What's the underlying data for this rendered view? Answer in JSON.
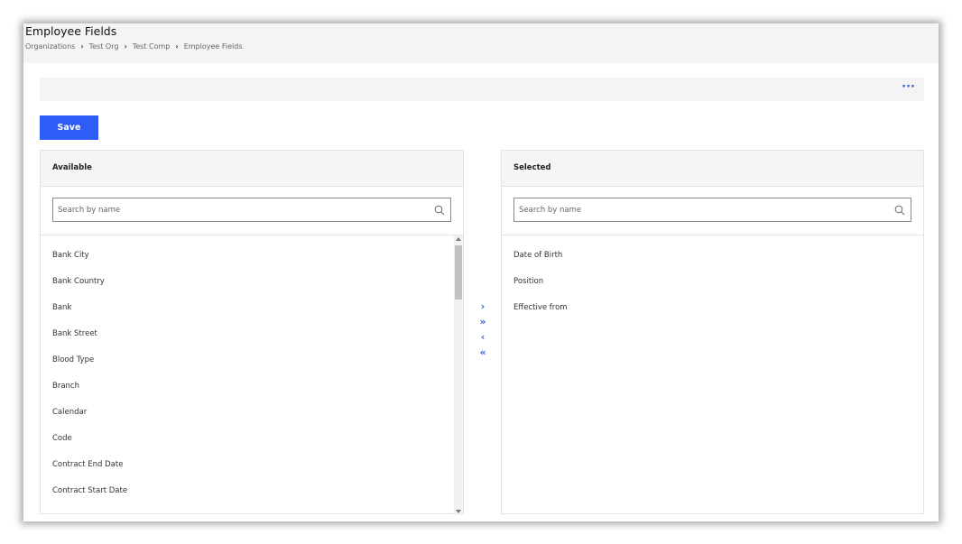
{
  "header": {
    "title": "Employee Fields",
    "breadcrumb": [
      "Organizations",
      "Test Org",
      "Test Comp",
      "Employee Fields"
    ]
  },
  "toolbar": {
    "more_label": "···",
    "save_label": "Save"
  },
  "available": {
    "title": "Available",
    "search_placeholder": "Search by name",
    "items": [
      "Bank City",
      "Bank Country",
      "Bank",
      "Bank Street",
      "Blood Type",
      "Branch",
      "Calendar",
      "Code",
      "Contract End Date",
      "Contract Start Date"
    ]
  },
  "selected": {
    "title": "Selected",
    "search_placeholder": "Search by name",
    "items": [
      "Date of Birth",
      "Position",
      "Effective from"
    ]
  },
  "transfer": {
    "move_right": "›",
    "move_all_right": "»",
    "move_left": "‹",
    "move_all_left": "«"
  },
  "colors": {
    "accent": "#2d5cf6",
    "header_bg": "#f4f4f5"
  }
}
